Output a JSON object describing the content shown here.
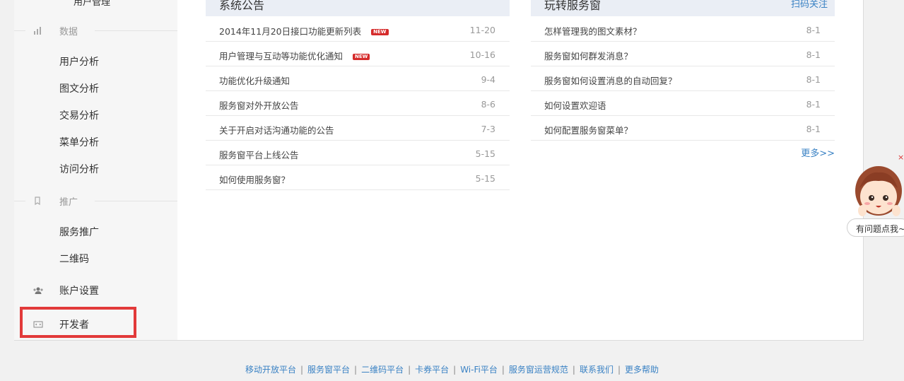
{
  "sidebar": {
    "cut_item": "用户管理",
    "data_section": {
      "title": "数据",
      "icon": "bar-chart-icon"
    },
    "data_items": [
      "用户分析",
      "图文分析",
      "交易分析",
      "菜单分析",
      "访问分析"
    ],
    "promo_section": {
      "title": "推广",
      "icon": "bookmark-icon"
    },
    "promo_items": [
      "服务推广",
      "二维码"
    ],
    "account": {
      "label": "账户设置",
      "icon": "users-icon"
    },
    "developer": {
      "label": "开发者",
      "icon": "code-icon"
    }
  },
  "announcements": {
    "title": "系统公告",
    "new_label": "NEW",
    "items": [
      {
        "text": "2014年11月20日接口功能更新列表",
        "date": "11-20",
        "is_new": true
      },
      {
        "text": "用户管理与互动等功能优化通知",
        "date": "10-16",
        "is_new": true
      },
      {
        "text": "功能优化升级通知",
        "date": "9-4",
        "is_new": false
      },
      {
        "text": "服务窗对外开放公告",
        "date": "8-6",
        "is_new": false
      },
      {
        "text": "关于开启对话沟通功能的公告",
        "date": "7-3",
        "is_new": false
      },
      {
        "text": "服务窗平台上线公告",
        "date": "5-15",
        "is_new": false
      },
      {
        "text": "如何使用服务窗？",
        "date": "5-15",
        "is_new": false
      }
    ]
  },
  "guide": {
    "title": "玩转服务窗",
    "scan_link": "扫码关注",
    "items": [
      {
        "text": "怎样管理我的图文素材？",
        "date": "8-1"
      },
      {
        "text": "服务窗如何群发消息？",
        "date": "8-1"
      },
      {
        "text": "服务窗如何设置消息的自动回复？",
        "date": "8-1"
      },
      {
        "text": "如何设置欢迎语",
        "date": "8-1"
      },
      {
        "text": "如何配置服务窗菜单？",
        "date": "8-1"
      }
    ],
    "more": "更多>>"
  },
  "helper": {
    "close": "×",
    "bubble": "有问题点我~"
  },
  "footer": {
    "links": [
      "移动开放平台",
      "服务窗平台",
      "二维码平台",
      "卡券平台",
      "Wi-Fi平台",
      "服务窗运营规范",
      "联系我们",
      "更多帮助"
    ],
    "separator": "|"
  },
  "colors": {
    "link": "#3a82c4",
    "highlight_border": "#e23a3a",
    "new_badge": "#d52b2b",
    "panel_header": "#eaeef5"
  }
}
